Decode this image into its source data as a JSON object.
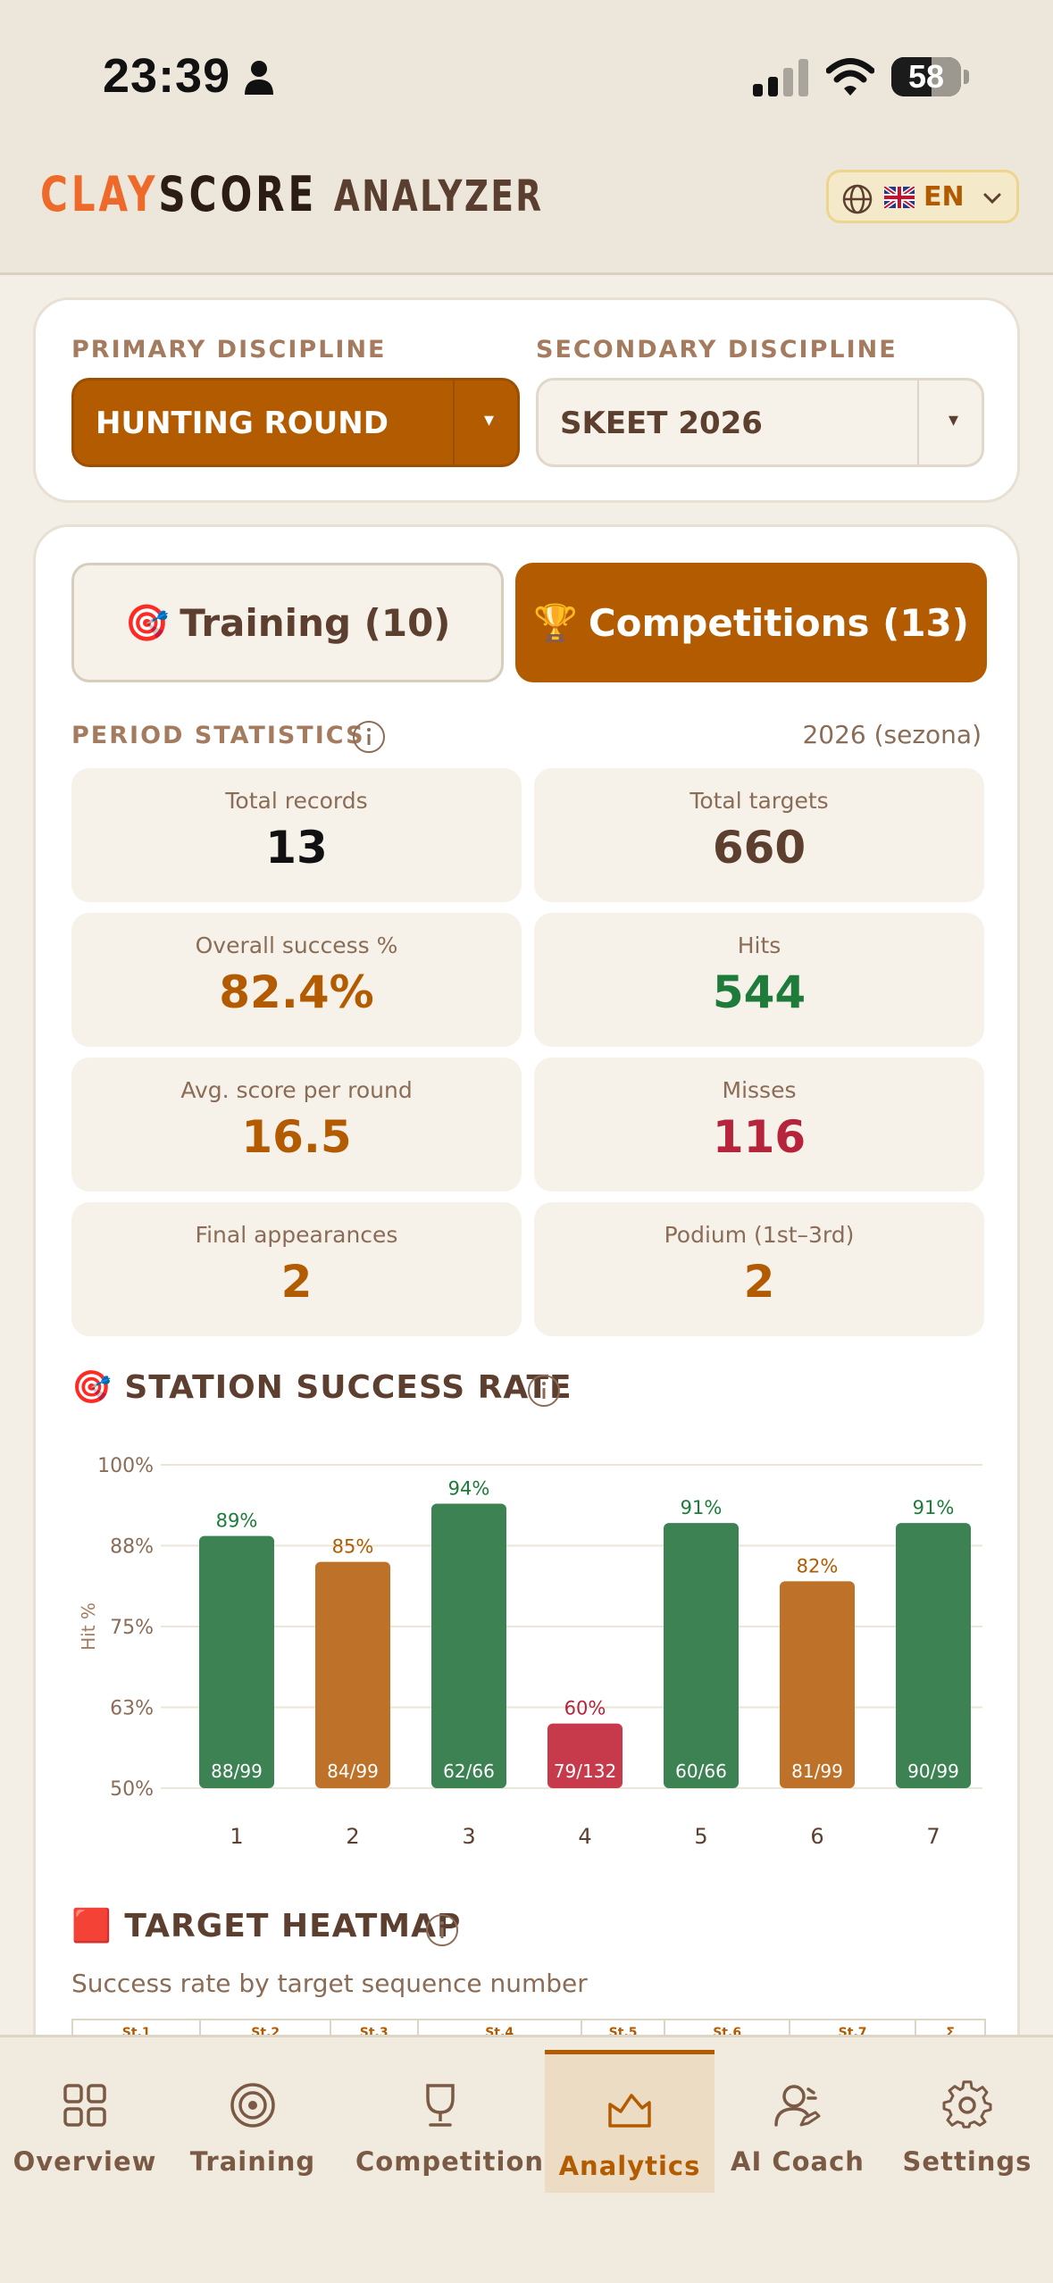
{
  "status_bar": {
    "time": "23:39",
    "battery": "58",
    "battery_percent": 58
  },
  "header": {
    "logo_clay": "CLAY",
    "logo_score": "SCORE",
    "logo_analyzer": "ANALYZER",
    "language": "EN",
    "flag": "🇬🇧",
    "icons": [
      "globe-icon",
      "flag-icon",
      "chevron-down-icon"
    ]
  },
  "disciplines": {
    "primary_label": "PRIMARY DISCIPLINE",
    "primary_value": "HUNTING ROUND",
    "secondary_label": "SECONDARY DISCIPLINE",
    "secondary_value": "SKEET 2026",
    "arrow": "▾"
  },
  "tabs": {
    "training": {
      "icon": "🎯",
      "label": "Training (10)"
    },
    "competitions": {
      "icon": "🏆",
      "label": "Competitions (13)",
      "active": true
    }
  },
  "period": {
    "label": "PERIOD STATISTICS",
    "value": "2026 (sezona)"
  },
  "stats": [
    {
      "label": "Total records",
      "value": "13",
      "color": "#111111"
    },
    {
      "label": "Total targets",
      "value": "660",
      "color": "#5c3f2f"
    },
    {
      "label": "Overall success %",
      "value": "82.4%",
      "color": "#b35b00"
    },
    {
      "label": "Hits",
      "value": "544",
      "color": "#1e7b3a"
    },
    {
      "label": "Avg. score per round",
      "value": "16.5",
      "color": "#b35b00"
    },
    {
      "label": "Misses",
      "value": "116",
      "color": "#b5243a"
    },
    {
      "label": "Final appearances",
      "value": "2",
      "color": "#b35b00"
    },
    {
      "label": "Podium (1st–3rd)",
      "value": "2",
      "color": "#b35b00"
    }
  ],
  "station_chart_title": {
    "icon": "🎯",
    "label": "STATION SUCCESS RATE"
  },
  "chart_data": {
    "type": "bar",
    "title": "STATION SUCCESS RATE",
    "xlabel": "",
    "ylabel": "Hit %",
    "categories": [
      "1",
      "2",
      "3",
      "4",
      "5",
      "6",
      "7"
    ],
    "values": [
      89,
      85,
      94,
      60,
      91,
      82,
      91
    ],
    "value_labels": [
      "89%",
      "85%",
      "94%",
      "60%",
      "91%",
      "82%",
      "91%"
    ],
    "hit_labels": [
      "88/99",
      "84/99",
      "62/66",
      "79/132",
      "60/66",
      "81/99",
      "90/99"
    ],
    "bar_colors": [
      "#3d8252",
      "#be7128",
      "#3d8252",
      "#c63a4b",
      "#3d8252",
      "#be7128",
      "#3d8252"
    ],
    "label_colors": [
      "#1e7b3a",
      "#b35b00",
      "#1e7b3a",
      "#b5243a",
      "#1e7b3a",
      "#b35b00",
      "#1e7b3a"
    ],
    "yticks": [
      "100%",
      "88%",
      "75%",
      "63%",
      "50%"
    ],
    "ylim": [
      50,
      100
    ],
    "grid": true
  },
  "heatmap": {
    "icon": "🟥",
    "title": "TARGET HEATMAP",
    "subtitle": "Success rate by target sequence number",
    "columns": [
      "St.1",
      "St.2",
      "St.3",
      "St.4",
      "St.5",
      "St.6",
      "St.7",
      "Σ"
    ]
  },
  "nav": [
    {
      "label": "Overview",
      "icon": "grid-icon"
    },
    {
      "label": "Training",
      "icon": "target-icon"
    },
    {
      "label": "Competitions",
      "icon": "trophy-icon"
    },
    {
      "label": "Analytics",
      "icon": "chart-icon",
      "active": true
    },
    {
      "label": "AI Coach",
      "icon": "coach-icon"
    },
    {
      "label": "Settings",
      "icon": "gear-icon"
    }
  ]
}
